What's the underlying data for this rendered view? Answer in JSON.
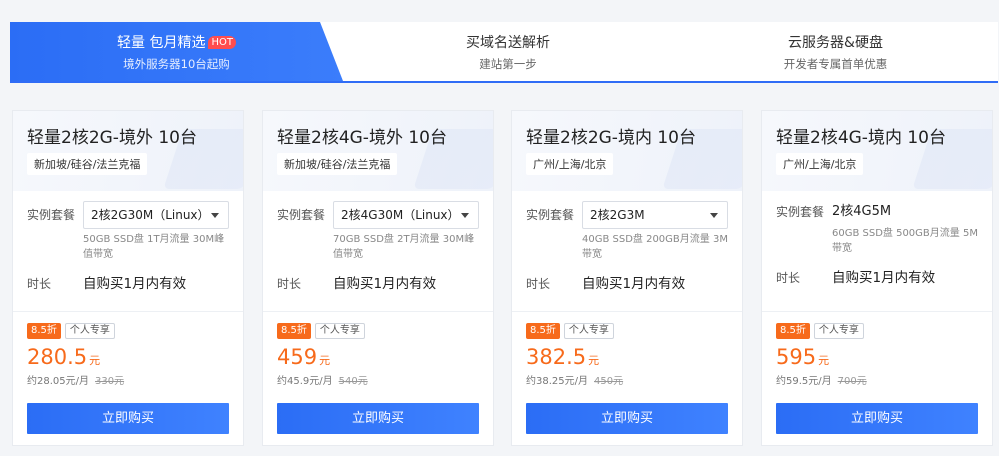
{
  "tabs": [
    {
      "title": "轻量 包月精选",
      "badge": "HOT",
      "sub": "境外服务器10台起购"
    },
    {
      "title": "买域名送解析",
      "sub": "建站第一步"
    },
    {
      "title": "云服务器&硬盘",
      "sub": "开发者专属首单优惠"
    }
  ],
  "labels": {
    "package": "实例套餐",
    "duration": "时长",
    "buy": "立即购买"
  },
  "cards": [
    {
      "title": "轻量2核2G-境外 10台",
      "region": "新加坡/硅谷/法兰克福",
      "package": "2核2G30M（Linux）",
      "spec": "50GB SSD盘 1T月流量 30M峰值带宽",
      "duration": "自购买1月内有效",
      "discount": "8.5折",
      "tag": "个人专享",
      "price": "280.5",
      "unit": "元",
      "monthly": "约28.05元/月",
      "original": "330元"
    },
    {
      "title": "轻量2核4G-境外 10台",
      "region": "新加坡/硅谷/法兰克福",
      "package": "2核4G30M（Linux）",
      "spec": "70GB SSD盘 2T月流量 30M峰值带宽",
      "duration": "自购买1月内有效",
      "discount": "8.5折",
      "tag": "个人专享",
      "price": "459",
      "unit": "元",
      "monthly": "约45.9元/月",
      "original": "540元"
    },
    {
      "title": "轻量2核2G-境内 10台",
      "region": "广州/上海/北京",
      "package": "2核2G3M",
      "spec": "40GB SSD盘 200GB月流量 3M带宽",
      "duration": "自购买1月内有效",
      "discount": "8.5折",
      "tag": "个人专享",
      "price": "382.5",
      "unit": "元",
      "monthly": "约38.25元/月",
      "original": "450元"
    },
    {
      "title": "轻量2核4G-境内 10台",
      "region": "广州/上海/北京",
      "package": "2核4G5M",
      "spec": "60GB SSD盘 500GB月流量 5M带宽",
      "duration": "自购买1月内有效",
      "discount": "8.5折",
      "tag": "个人专享",
      "price": "595",
      "unit": "元",
      "monthly": "约59.5元/月",
      "original": "700元"
    }
  ]
}
